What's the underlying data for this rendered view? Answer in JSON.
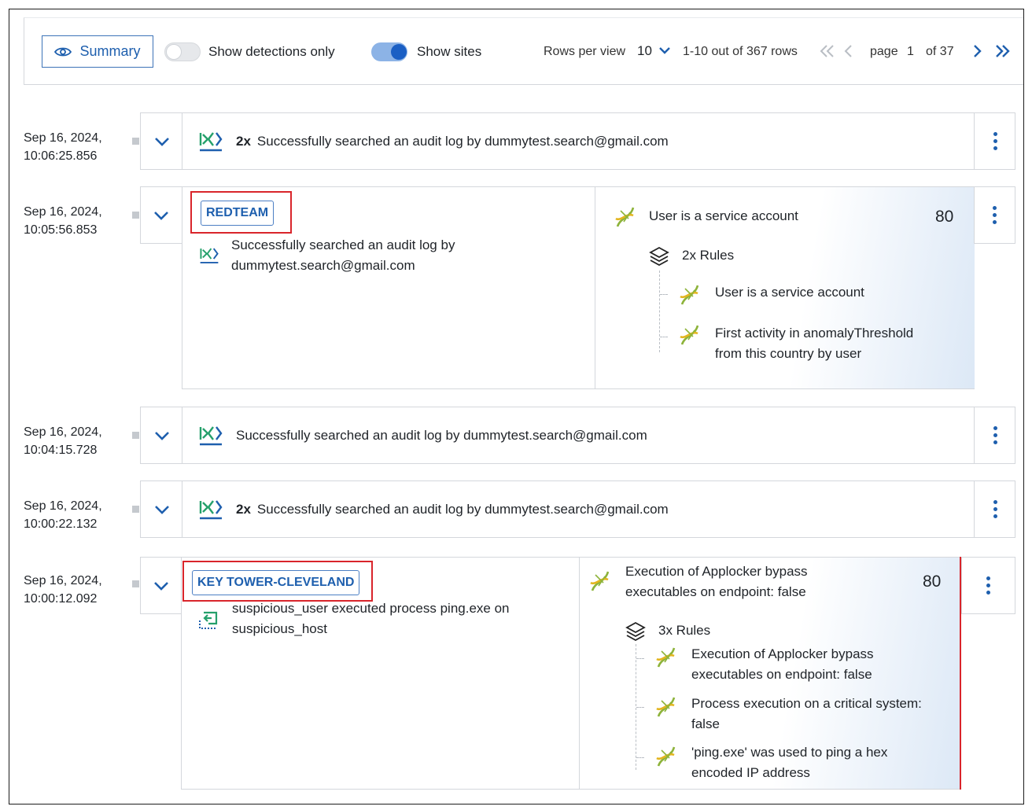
{
  "toolbar": {
    "summary_label": "Summary",
    "show_detections_label": "Show detections only",
    "show_detections_on": false,
    "show_sites_label": "Show sites",
    "show_sites_on": true,
    "rows_per_view_label": "Rows per view",
    "rows_per_view_value": "10",
    "row_count": "1-10 out of 367 rows",
    "page_label": "page",
    "page_current": "1",
    "page_total": "of 37"
  },
  "rows": [
    {
      "date": "Sep 16, 2024,",
      "time": "10:06:25.856",
      "count": "2x",
      "text": "Successfully searched an audit log by dummytest.search@gmail.com"
    },
    {
      "date": "Sep 16, 2024,",
      "time": "10:05:56.853",
      "site": "REDTEAM",
      "text_line1": "Successfully searched an audit log by",
      "text_line2": "dummytest.search@gmail.com",
      "detection": {
        "title": "User is a service account",
        "score": "80",
        "rules_label": "2x Rules",
        "rules": [
          {
            "line1": "User is a service account",
            "line2": ""
          },
          {
            "line1": "First activity in anomalyThreshold",
            "line2": "from this country by user"
          }
        ]
      }
    },
    {
      "date": "Sep 16, 2024,",
      "time": "10:04:15.728",
      "count": "",
      "text": "Successfully searched an audit log by dummytest.search@gmail.com"
    },
    {
      "date": "Sep 16, 2024,",
      "time": "10:00:22.132",
      "count": "2x",
      "text": "Successfully searched an audit log by dummytest.search@gmail.com"
    },
    {
      "date": "Sep 16, 2024,",
      "time": "10:00:12.092",
      "site": "KEY TOWER-CLEVELAND",
      "text_line1": "suspicious_user executed process ping.exe on",
      "text_line2": "suspicious_host",
      "detection": {
        "title_line1": "Execution of Applocker bypass",
        "title_line2": "executables on endpoint: false",
        "score": "80",
        "rules_label": "3x Rules",
        "rules": [
          {
            "line1": "Execution of Applocker bypass",
            "line2": "executables on endpoint: false"
          },
          {
            "line1": "Process execution on a critical system:",
            "line2": "false"
          },
          {
            "line1": "'ping.exe' was used to ping a hex",
            "line2": "encoded IP address"
          }
        ]
      }
    }
  ],
  "colors": {
    "accent": "#1e5fae",
    "highlight": "#d9252b",
    "dna_green": "#8db33a",
    "dna_yellow": "#e3b51f",
    "audit_icon": "#25a06b"
  },
  "icons": [
    "eye-icon",
    "chevron-down-icon",
    "first-page-icon",
    "prev-page-icon",
    "next-page-icon",
    "last-page-icon",
    "audit-log-icon",
    "process-icon",
    "dna-icon",
    "layers-icon",
    "kebab-menu-icon"
  ]
}
